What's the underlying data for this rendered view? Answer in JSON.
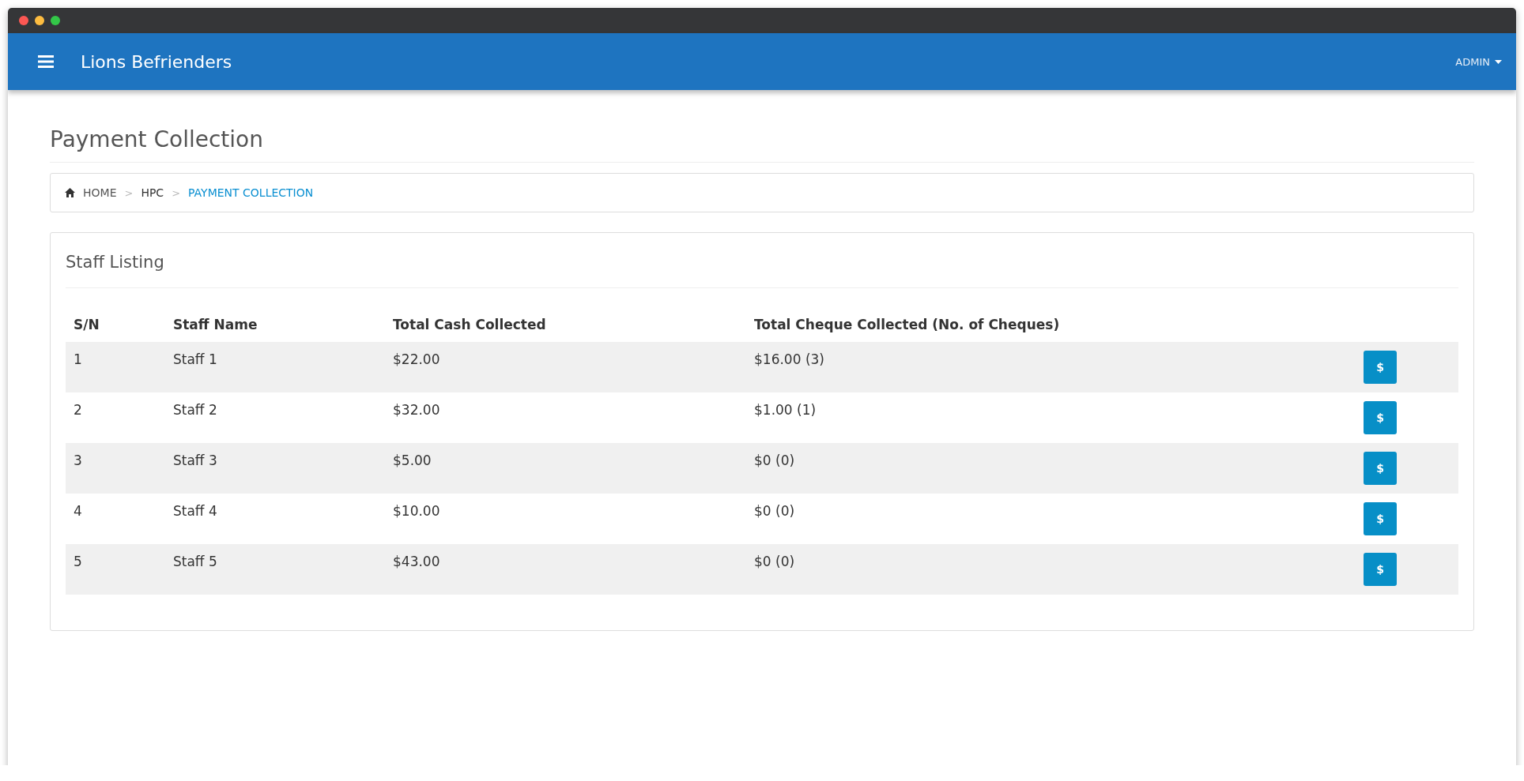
{
  "header": {
    "title": "Lions Befrienders",
    "user": "ADMIN"
  },
  "page_title": "Payment Collection",
  "breadcrumb": [
    {
      "label": "HOME",
      "current": false,
      "kind": "home"
    },
    {
      "label": "HPC",
      "current": false,
      "kind": "plain",
      "separator": ">"
    },
    {
      "label": "PAYMENT COLLECTION",
      "current": true,
      "kind": "plain",
      "separator": ">"
    }
  ],
  "card": {
    "title": "Staff Listing",
    "table": {
      "columns": [
        "S/N",
        "Staff Name",
        "Total Cash Collected",
        "Total Cheque Collected (No. of Cheques)"
      ],
      "rows": [
        {
          "cells": [
            "1",
            "Staff 1",
            "$22.00",
            "$16.00 (3)"
          ],
          "button": "$"
        },
        {
          "cells": [
            "2",
            "Staff 2",
            "$32.00",
            "$1.00 (1)"
          ],
          "button": "$"
        },
        {
          "cells": [
            "3",
            "Staff 3",
            "$5.00",
            "$0 (0)"
          ],
          "button": "$"
        },
        {
          "cells": [
            "4",
            "Staff 4",
            "$10.00",
            "$0 (0)"
          ],
          "button": "$"
        },
        {
          "cells": [
            "5",
            "Staff 5",
            "$43.00",
            "$0 (0)"
          ],
          "button": "$"
        }
      ]
    }
  }
}
